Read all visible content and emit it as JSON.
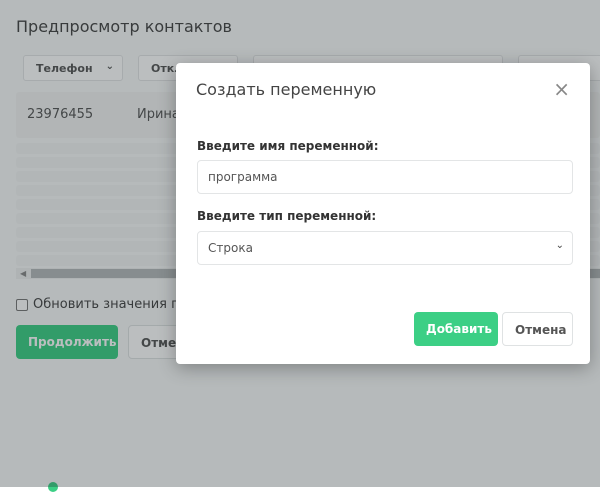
{
  "page": {
    "title": "Предпросмотр контактов",
    "column_selects": [
      "Телефон",
      "Откл"
    ],
    "first_row": {
      "phone": "23976455",
      "name": "Ирина"
    },
    "update_checkbox_label": "Обновить значения пер",
    "continue_label": "Продолжить",
    "cancel_label": "Отмен"
  },
  "modal": {
    "title": "Создать переменную",
    "close_icon": "close-icon",
    "name_label": "Введите имя переменной:",
    "name_value": "программа",
    "type_label": "Введите тип переменной:",
    "type_value": "Строка",
    "add_label": "Добавить",
    "cancel_label": "Отмена"
  },
  "colors": {
    "accent": "#3ccf85"
  }
}
